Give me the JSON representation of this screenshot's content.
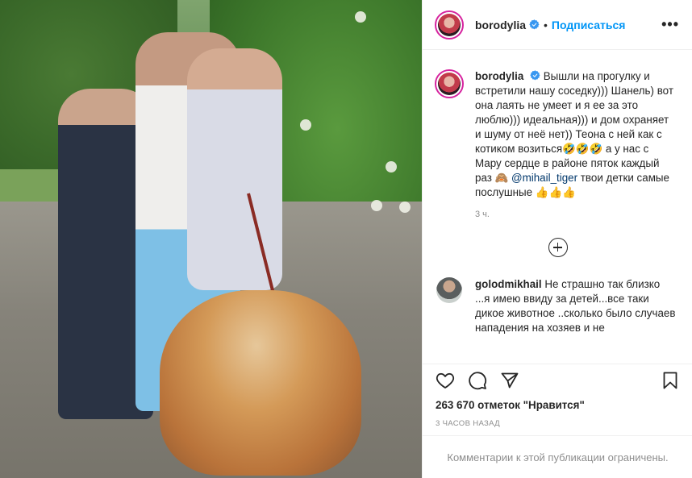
{
  "post": {
    "username": "borodylia",
    "separator": "•",
    "follow_label": "Подписаться",
    "more_label": "•••"
  },
  "caption": {
    "username": "borodylia",
    "text_before_mention": "Вышли на прогулку и встретили нашу соседку))) Шанель) вот она лаять не умеет и я ее за это люблю))) идеальная))) и дом охраняет и шуму от неё нет)) Теона с ней как с котиком возиться🤣🤣🤣 а у нас с Мару сердце в районе пяток каждый раз 🙈 ",
    "mention": "@mihail_tiger",
    "text_after_mention": " твои детки самые послушные 👍👍👍",
    "time": "3 ч."
  },
  "comment": {
    "username": "golodmikhail",
    "text": "Не страшно так близко ...я имею ввиду за детей...все таки дикое животное ..сколько было случаев нападения на хозяев и не"
  },
  "stats": {
    "likes": "263 670 отметок \"Нравится\"",
    "ago": "3 часов назад"
  },
  "footer": {
    "restricted": "Комментарии к этой публикации ограничены."
  },
  "colors": {
    "accent": "#0095f6",
    "mention": "#00376b",
    "muted": "#8e8e8e",
    "verified": "#3897f0"
  }
}
